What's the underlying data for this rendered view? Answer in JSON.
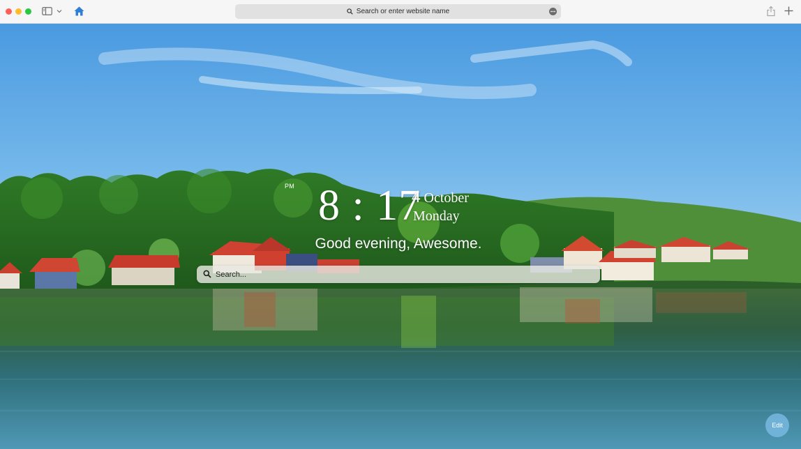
{
  "browser": {
    "address_placeholder": "Search or enter website name",
    "traffic_colors": {
      "close": "#ff5f57",
      "minimize": "#febc2e",
      "zoom": "#28c840"
    },
    "home_icon_color": "#2f7fd6"
  },
  "clock": {
    "period": "PM",
    "time": "8 : 17",
    "day": "4",
    "month": "October",
    "weekday": "Monday"
  },
  "greeting": "Good evening, Awesome.",
  "search": {
    "placeholder": "Search..."
  },
  "edit_button_label": "Edit",
  "icons": {
    "sidebar": "sidebar-icon",
    "chevron": "chevron-down-icon",
    "home": "home-icon",
    "address_search": "search-icon",
    "more": "more-icon",
    "share": "share-icon",
    "new_tab": "plus-icon",
    "page_search": "search-icon"
  }
}
